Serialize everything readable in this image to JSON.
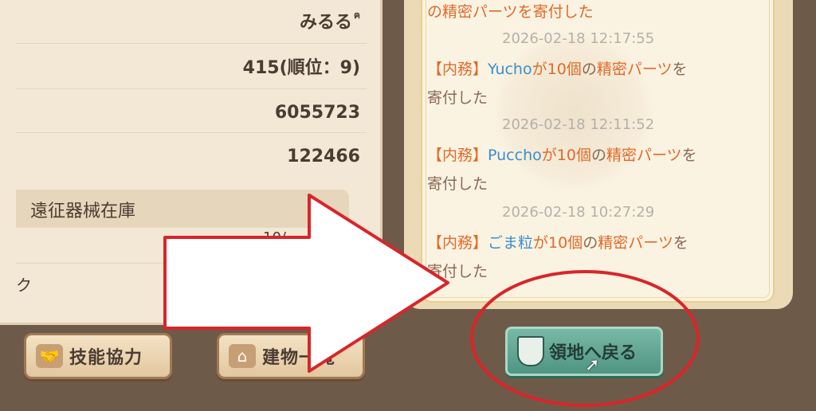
{
  "profile": {
    "name": "みるる",
    "name_glyph": "ฅ",
    "rank_value": "415(順位：9)",
    "stat_a": "6055723",
    "stat_b": "122466",
    "section_title": "遠征器械在庫",
    "partial_left": "ク",
    "partial_mid": "10/"
  },
  "buttons": {
    "skill": {
      "label": "技能協力",
      "icon": "handshake-icon"
    },
    "building": {
      "label": "建物一覧",
      "icon": "house-icon"
    }
  },
  "log": {
    "top_line": "の精密パーツを寄付した",
    "entries": [
      {
        "time": "2026-02-18 12:17:55",
        "category": "【内務】",
        "user": "Yucho",
        "ga": "が",
        "count": "10個",
        "no": "の",
        "item": "精密パーツ",
        "suffix": "を",
        "tail": "寄付した"
      },
      {
        "time": "2026-02-18 12:11:52",
        "category": "【内務】",
        "user": "Puccho",
        "ga": "が",
        "count": "10個",
        "no": "の",
        "item": "精密パーツ",
        "suffix": "を",
        "tail": "寄付した"
      },
      {
        "time": "2026-02-18 10:27:29",
        "category": "【内務】",
        "user": "ごま粒",
        "ga": "が",
        "count": "10個",
        "no": "の",
        "item": "精密パーツ",
        "suffix": "を",
        "tail": "寄付した"
      }
    ]
  },
  "return_button": {
    "label": "領地へ戻る",
    "icon": "banner-icon"
  },
  "annotations": {
    "arrow_color": "#d9252a",
    "circle_color": "#d9252a"
  }
}
